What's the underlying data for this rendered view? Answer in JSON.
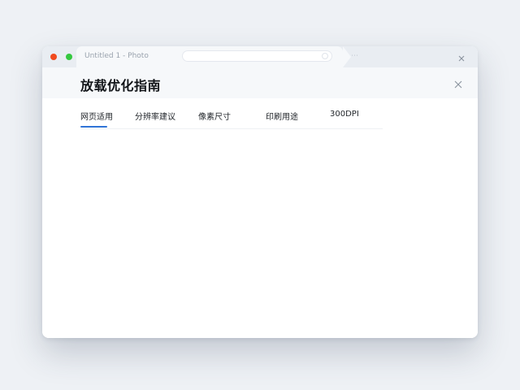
{
  "window": {
    "tab_title": "Untitled 1 - Photo",
    "address": ""
  },
  "dialog": {
    "title": "放载优化指南"
  },
  "tabs": [
    {
      "label": "网页适用",
      "active": true
    },
    {
      "label": "分辨率建议",
      "active": false
    },
    {
      "label": "像素尺寸",
      "active": false
    },
    {
      "label": "印刷用途",
      "active": false
    },
    {
      "label": "300DPI",
      "active": false
    }
  ],
  "icons": {
    "window_close": "close-icon",
    "dialog_close": "close-icon"
  },
  "colors": {
    "accent": "#2f73d6",
    "traffic_red": "#f04a1e",
    "traffic_green": "#35c83f"
  }
}
